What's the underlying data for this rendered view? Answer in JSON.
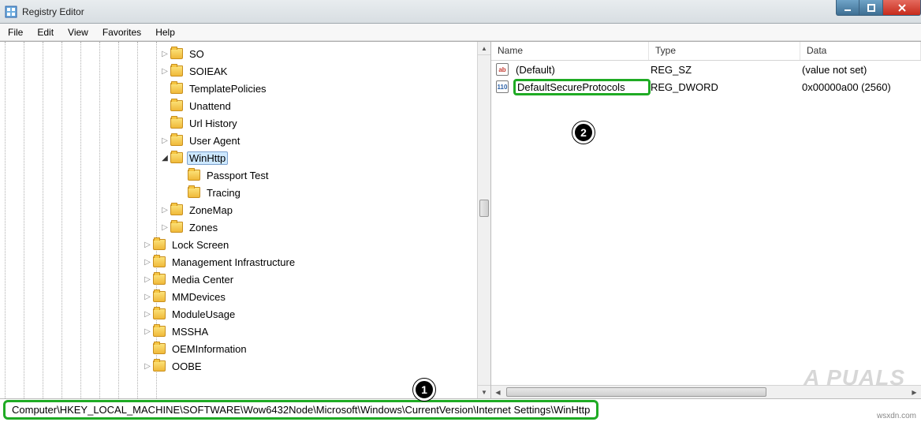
{
  "window": {
    "title": "Registry Editor"
  },
  "menu": {
    "items": [
      "File",
      "Edit",
      "View",
      "Favorites",
      "Help"
    ]
  },
  "tree": {
    "indentPositions": [
      6,
      30,
      54,
      78,
      102,
      126,
      150,
      174,
      198
    ],
    "nodes": [
      {
        "label": "SO",
        "level": 9,
        "expander": "closed"
      },
      {
        "label": "SOIEAK",
        "level": 9,
        "expander": "closed"
      },
      {
        "label": "TemplatePolicies",
        "level": 9,
        "expander": "none"
      },
      {
        "label": "Unattend",
        "level": 9,
        "expander": "none"
      },
      {
        "label": "Url History",
        "level": 9,
        "expander": "none"
      },
      {
        "label": "User Agent",
        "level": 9,
        "expander": "closed"
      },
      {
        "label": "WinHttp",
        "level": 9,
        "expander": "open",
        "selected": true
      },
      {
        "label": "Passport Test",
        "level": 10,
        "expander": "none"
      },
      {
        "label": "Tracing",
        "level": 10,
        "expander": "none"
      },
      {
        "label": "ZoneMap",
        "level": 9,
        "expander": "closed"
      },
      {
        "label": "Zones",
        "level": 9,
        "expander": "closed"
      },
      {
        "label": "Lock Screen",
        "level": 8,
        "expander": "closed"
      },
      {
        "label": "Management Infrastructure",
        "level": 8,
        "expander": "closed"
      },
      {
        "label": "Media Center",
        "level": 8,
        "expander": "closed"
      },
      {
        "label": "MMDevices",
        "level": 8,
        "expander": "closed"
      },
      {
        "label": "ModuleUsage",
        "level": 8,
        "expander": "closed"
      },
      {
        "label": "MSSHA",
        "level": 8,
        "expander": "closed"
      },
      {
        "label": "OEMInformation",
        "level": 8,
        "expander": "none"
      },
      {
        "label": "OOBE",
        "level": 8,
        "expander": "closed"
      }
    ]
  },
  "list": {
    "columns": {
      "name": "Name",
      "type": "Type",
      "data": "Data"
    },
    "rows": [
      {
        "icon": "str",
        "name": "(Default)",
        "type": "REG_SZ",
        "data": "(value not set)",
        "highlight": false
      },
      {
        "icon": "bin",
        "name": "DefaultSecureProtocols",
        "type": "REG_DWORD",
        "data": "0x00000a00 (2560)",
        "highlight": true
      }
    ]
  },
  "status": {
    "path": "Computer\\HKEY_LOCAL_MACHINE\\SOFTWARE\\Wow6432Node\\Microsoft\\Windows\\CurrentVersion\\Internet Settings\\WinHttp"
  },
  "annotations": {
    "badge1": "1",
    "badge2": "2"
  },
  "watermark": "A  PUALS",
  "credit": "wsxdn.com"
}
